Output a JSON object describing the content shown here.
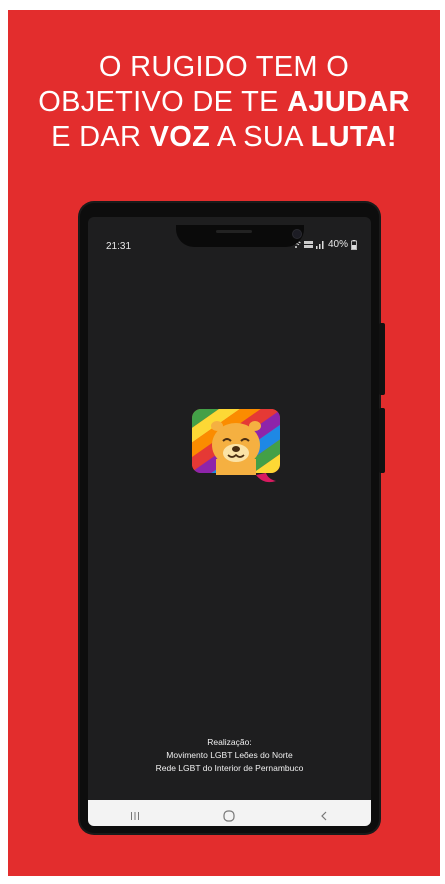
{
  "headline": {
    "line1": "O RUGIDO TEM O",
    "line2_a": "OBJETIVO DE TE ",
    "line2_b": "AJUDAR",
    "line3_a": "E DAR ",
    "line3_b": "VOZ",
    "line3_c": " A SUA ",
    "line3_d": "LUTA!"
  },
  "status_bar": {
    "time": "21:31",
    "battery": "40%",
    "icons": [
      "wifi-icon",
      "volte-icon",
      "signal-icon",
      "battery-icon"
    ]
  },
  "app_logo": {
    "icon": "lion-rainbow-chat-icon"
  },
  "credits": {
    "title": "Realização:",
    "line1": "Movimento LGBT Leões do Norte",
    "line2": "Rede LGBT do Interior de Pernambuco"
  },
  "navbar": {
    "recents": "|||",
    "home": "○",
    "back": "<"
  },
  "colors": {
    "background": "#e32d2d",
    "screen": "#1e1e1f",
    "text": "#ffffff"
  }
}
